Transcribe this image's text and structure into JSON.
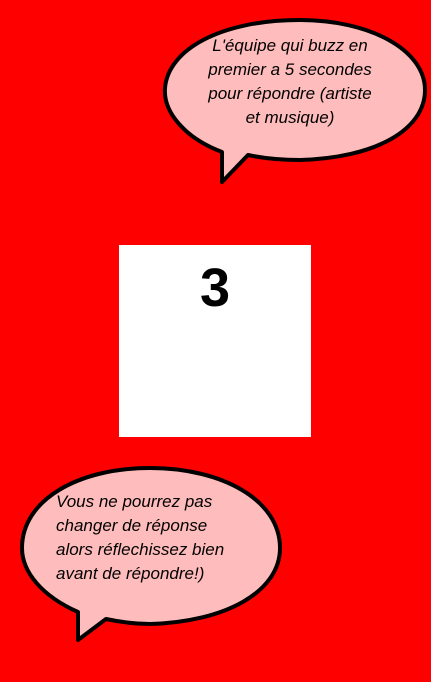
{
  "colors": {
    "background": "#fe0000",
    "bubble_fill": "#ffbcbc",
    "bubble_stroke": "#000000",
    "card": "#ffffff"
  },
  "bubble_top": {
    "lines": [
      "L'équipe qui buzz en",
      "premier a 5 secondes",
      "pour répondre (artiste",
      "et musique)"
    ]
  },
  "bubble_bottom": {
    "lines": [
      "Vous ne pourrez pas",
      "changer de réponse",
      "alors réflechissez bien",
      "avant de répondre!)"
    ]
  },
  "countdown": {
    "value": "3"
  }
}
